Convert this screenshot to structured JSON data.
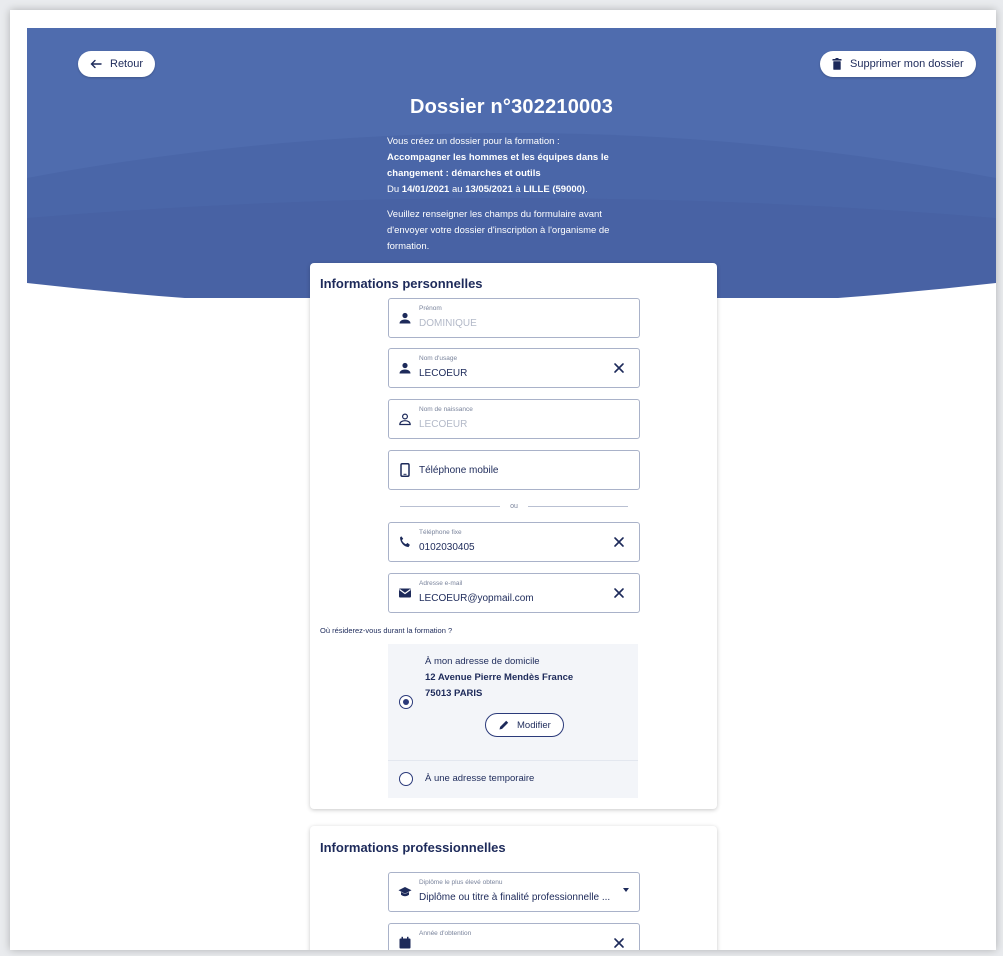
{
  "header": {
    "back_label": "Retour",
    "delete_label": "Supprimer mon dossier",
    "title": "Dossier n°302210003",
    "intro": "Vous créez un dossier pour la formation :",
    "course_name_line1": "Accompagner les hommes et les équipes dans le",
    "course_name_line2": "changement : démarches et outils",
    "dates_prefix": "Du ",
    "date_start": "14/01/2021",
    "dates_middle": " au ",
    "date_end": "13/05/2021",
    "location_prefix": " à ",
    "location": "LILLE (59000)",
    "location_suffix": ".",
    "instructions_line1": "Veuillez renseigner les champs du formulaire avant",
    "instructions_line2": "d'envoyer votre dossier d'inscription à l'organisme de",
    "instructions_line3": "formation."
  },
  "personal": {
    "title": "Informations personnelles",
    "first_name": {
      "label": "Prénom",
      "value": "DOMINIQUE"
    },
    "usage_name": {
      "label": "Nom d'usage",
      "value": "LECOEUR"
    },
    "birth_name": {
      "label": "Nom de naissance",
      "value": "LECOEUR"
    },
    "mobile": {
      "placeholder": "Téléphone mobile"
    },
    "or_label": "ou",
    "landline": {
      "label": "Téléphone fixe",
      "value": "0102030405"
    },
    "email": {
      "label": "Adresse e-mail",
      "value": "LECOEUR@yopmail.com"
    },
    "residence_question": "Où résiderez-vous durant la formation ?",
    "home_option": {
      "label": "À mon adresse de domicile",
      "street": "12 Avenue Pierre Mendès France",
      "city": "75013 PARIS",
      "modify_label": "Modifier"
    },
    "temporary_option": {
      "label": "À une adresse temporaire"
    }
  },
  "professional": {
    "title": "Informations professionnelles",
    "diploma": {
      "label": "Diplôme le plus élevé obtenu",
      "value": "Diplôme ou titre à finalité professionnelle ..."
    },
    "year": {
      "label": "Année d'obtention"
    }
  },
  "icons": {
    "back": "arrow-left-icon",
    "delete": "trash-icon",
    "person": "person-icon",
    "mobile": "mobile-phone-icon",
    "phone": "phone-icon",
    "email": "envelope-icon",
    "edit": "pencil-icon",
    "diploma": "graduation-cap-icon",
    "calendar": "calendar-icon",
    "clear": "close-icon"
  },
  "colors": {
    "header_bg": "#4f6cae",
    "primary_text": "#1d2a5a",
    "accent": "#2b3a7a"
  }
}
